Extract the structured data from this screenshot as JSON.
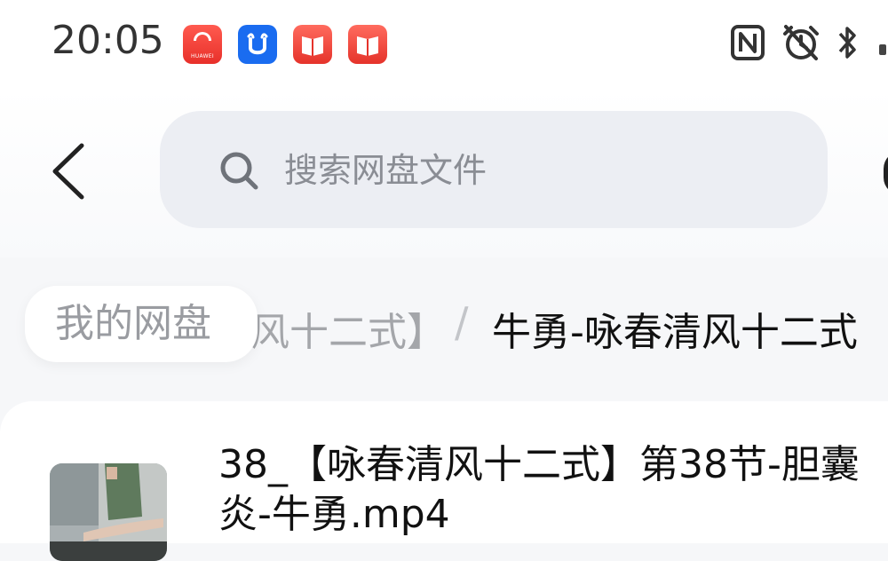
{
  "status_bar": {
    "time": "20:05",
    "huawei_text": "HUAWEI",
    "apps": [
      "huawei-appgallery-icon",
      "cow-app-icon",
      "red-book-icon",
      "red-book-icon"
    ],
    "right_icons": [
      "nfc-icon",
      "alarm-icon",
      "bluetooth-icon"
    ]
  },
  "header": {
    "back_icon": "chevron-left-icon",
    "search_placeholder": "搜索网盘文件"
  },
  "breadcrumb": {
    "root": "我的网盘",
    "middle": "风十二式】",
    "separator": "/",
    "current": "牛勇-咏春清风十二式"
  },
  "files": [
    {
      "name": "38_【咏春清风十二式】第38节-胆囊炎-牛勇.mp4"
    }
  ],
  "colors": {
    "accent": "#1a6cf0",
    "search_bg": "#eceef3",
    "page_bg": "#f6f7f9"
  }
}
